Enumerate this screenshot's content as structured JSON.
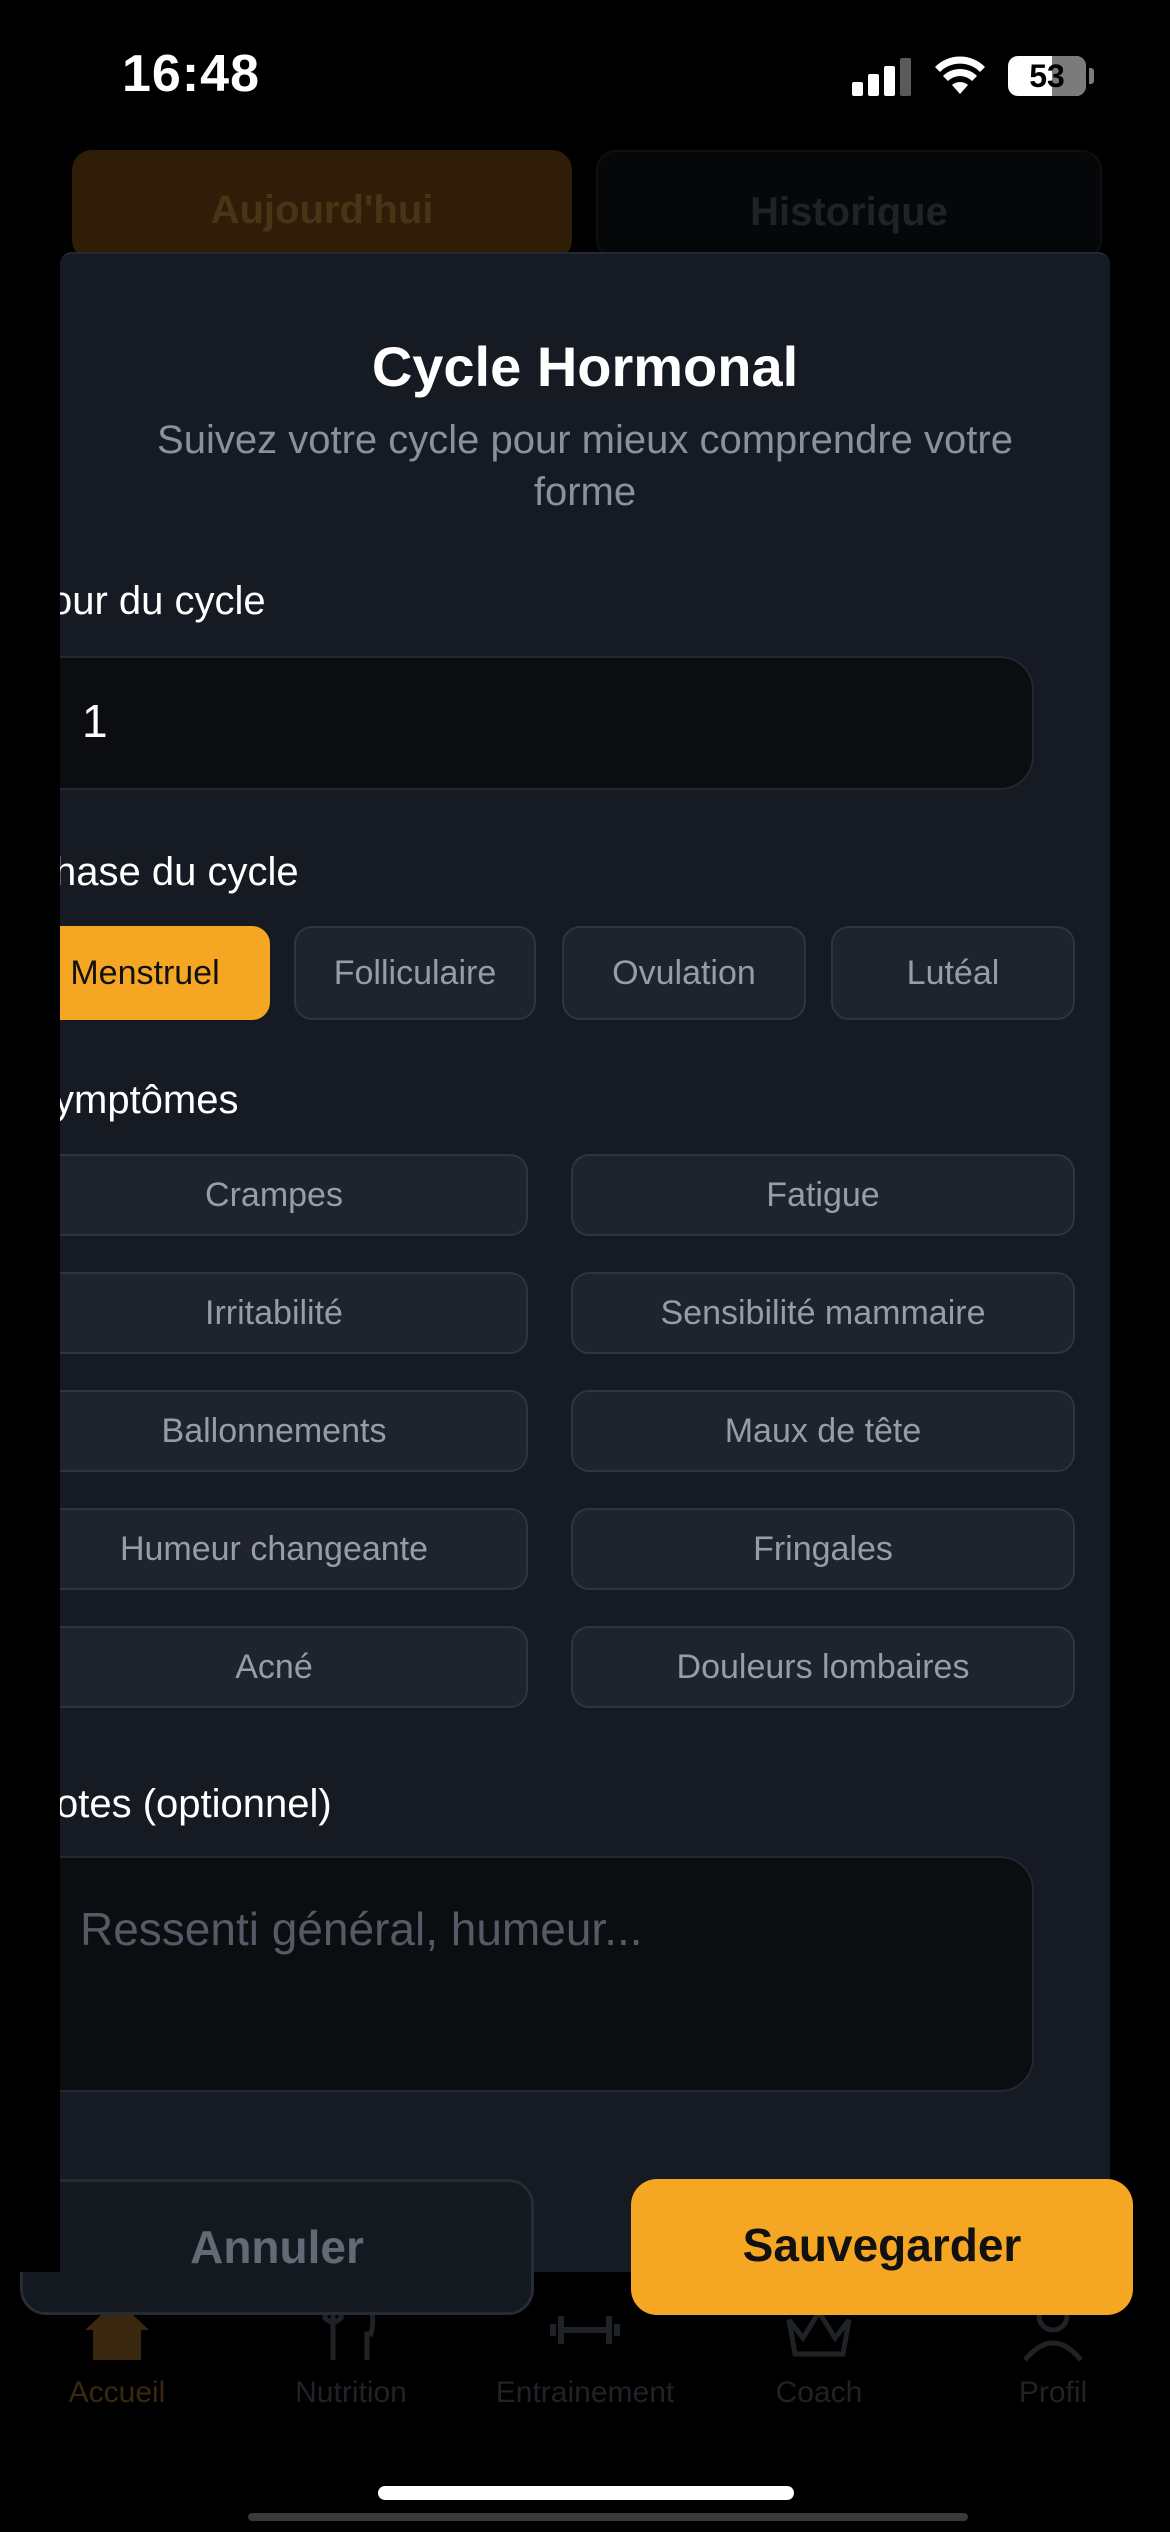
{
  "status_bar": {
    "time": "16:48",
    "battery": "53"
  },
  "background_tabs": {
    "today": "Aujourd'hui",
    "history": "Historique"
  },
  "modal": {
    "title": "Cycle Hormonal",
    "subtitle": "Suivez votre cycle pour mieux comprendre votre forme",
    "cycle_day": {
      "label": "Jour du cycle",
      "visible_label": "our du cycle",
      "value": "1"
    },
    "phase": {
      "label": "Phase du cycle",
      "visible_label": "hase du cycle",
      "options": [
        "Menstruel",
        "Folliculaire",
        "Ovulation",
        "Lutéal"
      ],
      "selected": "Menstruel"
    },
    "symptoms": {
      "label": "Symptômes",
      "visible_label": "ymptômes",
      "items": [
        "Crampes",
        "Fatigue",
        "Irritabilité",
        "Sensibilité mammaire",
        "Ballonnements",
        "Maux de tête",
        "Humeur changeante",
        "Fringales",
        "Acné",
        "Douleurs lombaires"
      ]
    },
    "notes": {
      "label": "Notes (optionnel)",
      "visible_label": "otes (optionnel)",
      "placeholder": "Ressenti général, humeur..."
    },
    "cancel_label": "Annuler",
    "save_label": "Sauvegarder"
  },
  "bottom_nav": {
    "items": [
      {
        "label": "Accueil",
        "icon": "home-icon"
      },
      {
        "label": "Nutrition",
        "icon": "fork-knife-icon"
      },
      {
        "label": "Entrainement",
        "icon": "dumbbell-icon"
      },
      {
        "label": "Coach",
        "icon": "crown-icon"
      },
      {
        "label": "Profil",
        "icon": "person-icon"
      }
    ],
    "active": "Accueil"
  },
  "colors": {
    "accent": "#f5a623",
    "modal_bg": "#161a22",
    "chip_bg": "#1f232c"
  }
}
